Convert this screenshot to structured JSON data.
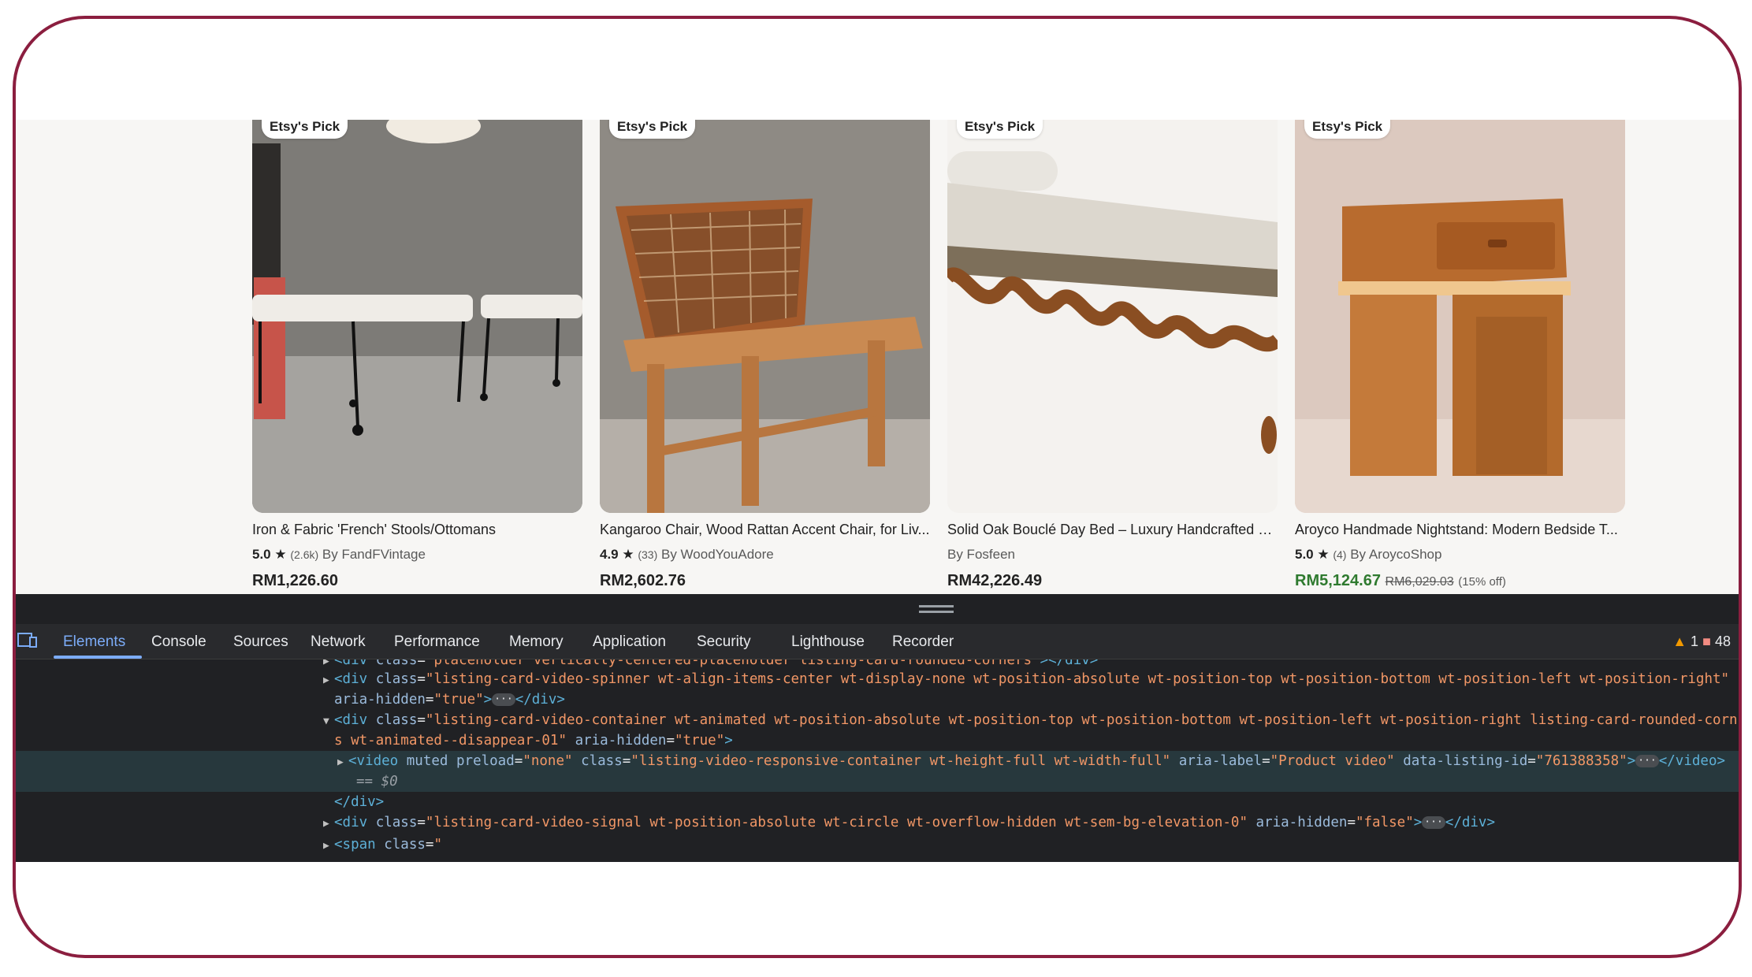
{
  "products": [
    {
      "badge": "Etsy's Pick",
      "title": "Iron & Fabric 'French' Stools/Ottomans",
      "rating": "5.0",
      "review_count": "(2.6k)",
      "shop": "By FandFVintage",
      "price": "RM1,226.60",
      "has_video": false
    },
    {
      "badge": "Etsy's Pick",
      "title": "Kangaroo Chair, Wood Rattan Accent Chair, for Liv...",
      "rating": "4.9",
      "review_count": "(33)",
      "shop": "By WoodYouAdore",
      "price": "RM2,602.76",
      "has_video": false
    },
    {
      "badge": "Etsy's Pick",
      "title": "Solid Oak Bouclé Day Bed – Luxury Handcrafted U...",
      "shop": "By Fosfeen",
      "price": "RM42,226.49",
      "has_video": true
    },
    {
      "badge": "Etsy's Pick",
      "title": "Aroyco Handmade Nightstand: Modern Bedside T...",
      "rating": "5.0",
      "review_count": "(4)",
      "shop": "By AroycoShop",
      "price": "RM5,124.67",
      "original_price": "RM6,029.03",
      "discount": "(15% off)",
      "has_video": true
    }
  ],
  "devtools": {
    "tabs": [
      "Elements",
      "Console",
      "Sources",
      "Network",
      "Performance",
      "Memory",
      "Application",
      "Security",
      "Lighthouse",
      "Recorder"
    ],
    "active_tab": "Elements",
    "warning_count": "1",
    "error_count": "48",
    "code": {
      "l0_tag": "<div ",
      "l0_attr": "class",
      "l0_val": "\"placeholder vertically-centered-placeholder listing-card-rounded-corners\"",
      "l0_end": "></div>",
      "l1_tag": "<div ",
      "l1_attr": "class",
      "l1_val": "\"listing-card-video-spinner wt-align-items-center wt-display-none wt-position-absolute wt-position-top wt-position-bottom wt-position-left wt-position-right\"",
      "l2_attr": "aria-hidden",
      "l2_val": "\"true\"",
      "l2_end": "</div>",
      "l3_tag": "<div ",
      "l3_attr": "class",
      "l3_val": "\"listing-card-video-container wt-animated wt-position-absolute wt-position-top wt-position-bottom wt-position-left wt-position-right listing-card-rounded-corn",
      "l4_val": "s wt-animated--disappear-01\"",
      "l4_attr": "aria-hidden",
      "l4_val2": "\"true\"",
      "l5_tag": "<video ",
      "l5_kw1": "muted",
      "l5_attr1": "preload",
      "l5_val1": "\"none\"",
      "l5_attr2": "class",
      "l5_val2": "\"listing-video-responsive-container wt-height-full wt-width-full\"",
      "l5_attr3": "aria-label",
      "l5_val3": "\"Product video\"",
      "l5_attr4": "data-listing-id",
      "l5_val4": "\"761388358\"",
      "l5_end": "</video>",
      "l6": "== $0",
      "l7": "</div>",
      "l8_tag": "<div ",
      "l8_attr": "class",
      "l8_val": "\"listing-card-video-signal wt-position-absolute wt-circle wt-overflow-hidden wt-sem-bg-elevation-0\"",
      "l8_attr2": "aria-hidden",
      "l8_val2": "\"false\"",
      "l8_end": "</div>",
      "l9_tag": "<span ",
      "l9_attr": "class",
      "l9_val": "\""
    }
  },
  "colors": {
    "frame_border": "#8b1e3f",
    "sale_price": "#2f7a2f",
    "devtools_bg": "#202124",
    "active_tab": "#7cacf8"
  }
}
